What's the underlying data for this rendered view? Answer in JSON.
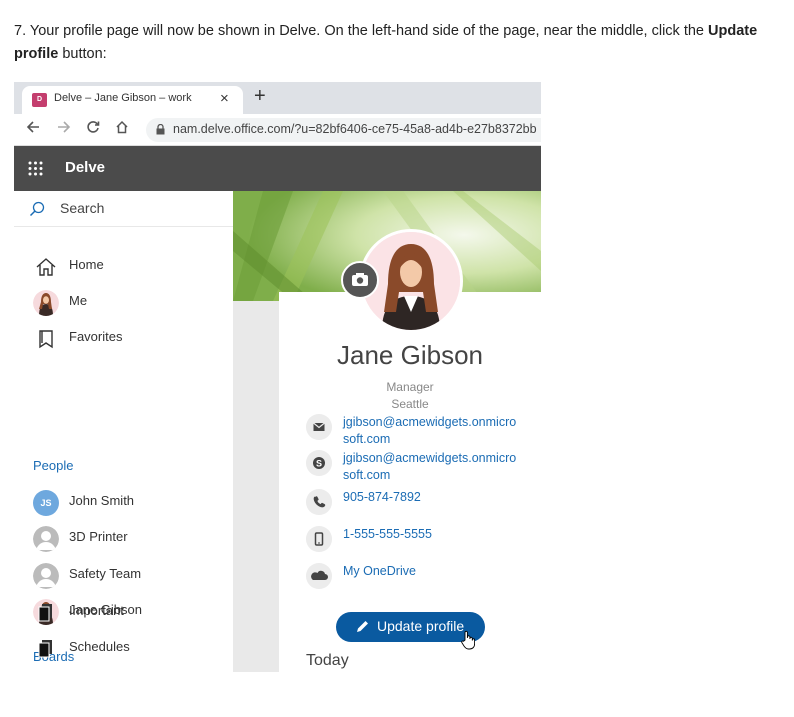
{
  "instruction": {
    "prefix": "7. Your profile page will now be shown in Delve. On the left-hand side of the page, near the middle, click the ",
    "bold_part": "Update profile",
    "suffix": " button:"
  },
  "browser": {
    "tab_title": "Delve – Jane Gibson – work",
    "tab_close": "×",
    "new_tab": "+",
    "url": "nam.delve.office.com/?u=82bf6406-ce75-45a8-ad4b-e27b8372bb"
  },
  "app": {
    "title": "Delve",
    "header_color": "#4b4b4b"
  },
  "sidebar": {
    "search_label": "Search",
    "nav": [
      {
        "label": "Home",
        "icon": "home-icon"
      },
      {
        "label": "Me",
        "icon": "avatar"
      },
      {
        "label": "Favorites",
        "icon": "bookmark-icon"
      }
    ],
    "people_heading": "People",
    "people": [
      {
        "label": "John Smith",
        "initials": "JS"
      },
      {
        "label": "3D Printer"
      },
      {
        "label": "Safety Team"
      },
      {
        "label": "Jane Gibson"
      }
    ],
    "boards_heading": "Boards",
    "boards": [
      {
        "label": "Important"
      },
      {
        "label": "Schedules"
      }
    ],
    "accent_color": "#1b6cb4"
  },
  "profile": {
    "name": "Jane Gibson",
    "title": "Manager",
    "location": "Seattle",
    "email": "jgibson@acmewidgets.onmicrosoft.com",
    "skype": "jgibson@acmewidgets.onmicrosoft.com",
    "phone": "905-874-7892",
    "mobile": "1-555-555-5555",
    "onedrive": "My OneDrive",
    "update_button": "Update profile",
    "button_color": "#0a5aa0",
    "today_heading": "Today"
  }
}
